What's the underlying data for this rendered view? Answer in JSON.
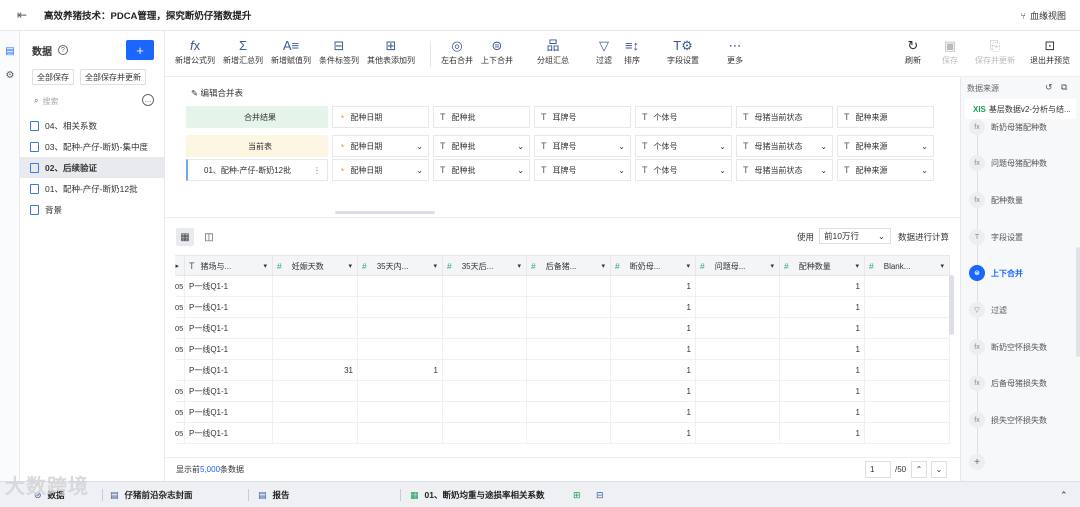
{
  "topbar": {
    "title": "高效养猪技术：PDCA管理，探究断奶仔猪数提升",
    "lineage_label": "血缘视图"
  },
  "sidebar": {
    "title": "数据",
    "save_all": "全部保存",
    "save_all_update": "全部保存并更新",
    "search_placeholder": "搜索",
    "items": [
      {
        "label": "04、相关系数"
      },
      {
        "label": "03、配种-产仔-断奶-集中度"
      },
      {
        "label": "02、后续验证"
      },
      {
        "label": "01、配种-产仔-断奶12批"
      },
      {
        "label": "背景"
      }
    ]
  },
  "toolbar": {
    "new_formula": "新增公式列",
    "new_summary": "新增汇总列",
    "new_assign": "新增赋值列",
    "cond_label": "条件标签列",
    "other_table": "其他表添加列",
    "lr_merge": "左右合并",
    "ud_merge": "上下合并",
    "group_summary": "分组汇总",
    "filter": "过滤",
    "sort": "排序",
    "field_settings": "字段设置",
    "more": "更多",
    "refresh": "刷新",
    "save": "保存",
    "save_update": "保存并更新",
    "exit_preview": "退出并预览"
  },
  "merge": {
    "edit_label": "编辑合并表",
    "result_label": "合并结果",
    "current_label": "当前表",
    "source_label": "01、配种-产仔-断奶12批",
    "columns": [
      "配种日期",
      "配种批",
      "耳牌号",
      "个体号",
      "母猪当前状态",
      "配种来源"
    ]
  },
  "grid": {
    "use_label": "使用",
    "rows_option": "前10万行",
    "calc_label": "数据进行计算",
    "headers": [
      "猪场与...",
      "妊娠天数",
      "35天内...",
      "35天后...",
      "后备猪...",
      "断奶母...",
      "问题母...",
      "配种数量",
      "Blank..."
    ],
    "rows": [
      {
        "pre": "05",
        "farm": "P一线Q1-1",
        "c1": "",
        "c2": "",
        "c3": "",
        "c4": "",
        "c5": "1",
        "c6": "",
        "c7": "1",
        "c8": ""
      },
      {
        "pre": "05",
        "farm": "P一线Q1-1",
        "c1": "",
        "c2": "",
        "c3": "",
        "c4": "",
        "c5": "1",
        "c6": "",
        "c7": "1",
        "c8": ""
      },
      {
        "pre": "05",
        "farm": "P一线Q1-1",
        "c1": "",
        "c2": "",
        "c3": "",
        "c4": "",
        "c5": "1",
        "c6": "",
        "c7": "1",
        "c8": ""
      },
      {
        "pre": "05",
        "farm": "P一线Q1-1",
        "c1": "",
        "c2": "",
        "c3": "",
        "c4": "",
        "c5": "1",
        "c6": "",
        "c7": "1",
        "c8": ""
      },
      {
        "pre": "",
        "farm": "P一线Q1-1",
        "c1": "31",
        "c2": "1",
        "c3": "",
        "c4": "",
        "c5": "1",
        "c6": "",
        "c7": "1",
        "c8": ""
      },
      {
        "pre": "05",
        "farm": "P一线Q1-1",
        "c1": "",
        "c2": "",
        "c3": "",
        "c4": "",
        "c5": "1",
        "c6": "",
        "c7": "1",
        "c8": ""
      },
      {
        "pre": "05",
        "farm": "P一线Q1-1",
        "c1": "",
        "c2": "",
        "c3": "",
        "c4": "",
        "c5": "1",
        "c6": "",
        "c7": "1",
        "c8": ""
      },
      {
        "pre": "05",
        "farm": "P一线Q1-1",
        "c1": "",
        "c2": "",
        "c3": "",
        "c4": "",
        "c5": "1",
        "c6": "",
        "c7": "1",
        "c8": ""
      }
    ],
    "footer_prefix": "显示前",
    "footer_count": "5,000",
    "footer_suffix": "条数据",
    "page_value": "1",
    "page_total": "/50"
  },
  "right_panel": {
    "title": "数据来源",
    "source": "基层数据v2-分析与结...",
    "steps": [
      {
        "label": "断奶母猪配种数",
        "icon": "fx"
      },
      {
        "label": "问题母猪配种数",
        "icon": "fx"
      },
      {
        "label": "配种数量",
        "icon": "fx"
      },
      {
        "label": "字段设置",
        "icon": "T"
      },
      {
        "label": "上下合并",
        "icon": "⊜"
      },
      {
        "label": "过滤",
        "icon": "▽"
      },
      {
        "label": "断奶空怀损失数",
        "icon": "fx"
      },
      {
        "label": "后备母猪损失数",
        "icon": "fx"
      },
      {
        "label": "损失空怀损失数",
        "icon": "fx"
      }
    ]
  },
  "bottombar": {
    "tab1": "数据",
    "tab2": "仔猪前沿杂志封面",
    "tab3": "报告",
    "tab4": "01、断奶均重与途损率相关系数"
  },
  "watermark": "大数跨境"
}
